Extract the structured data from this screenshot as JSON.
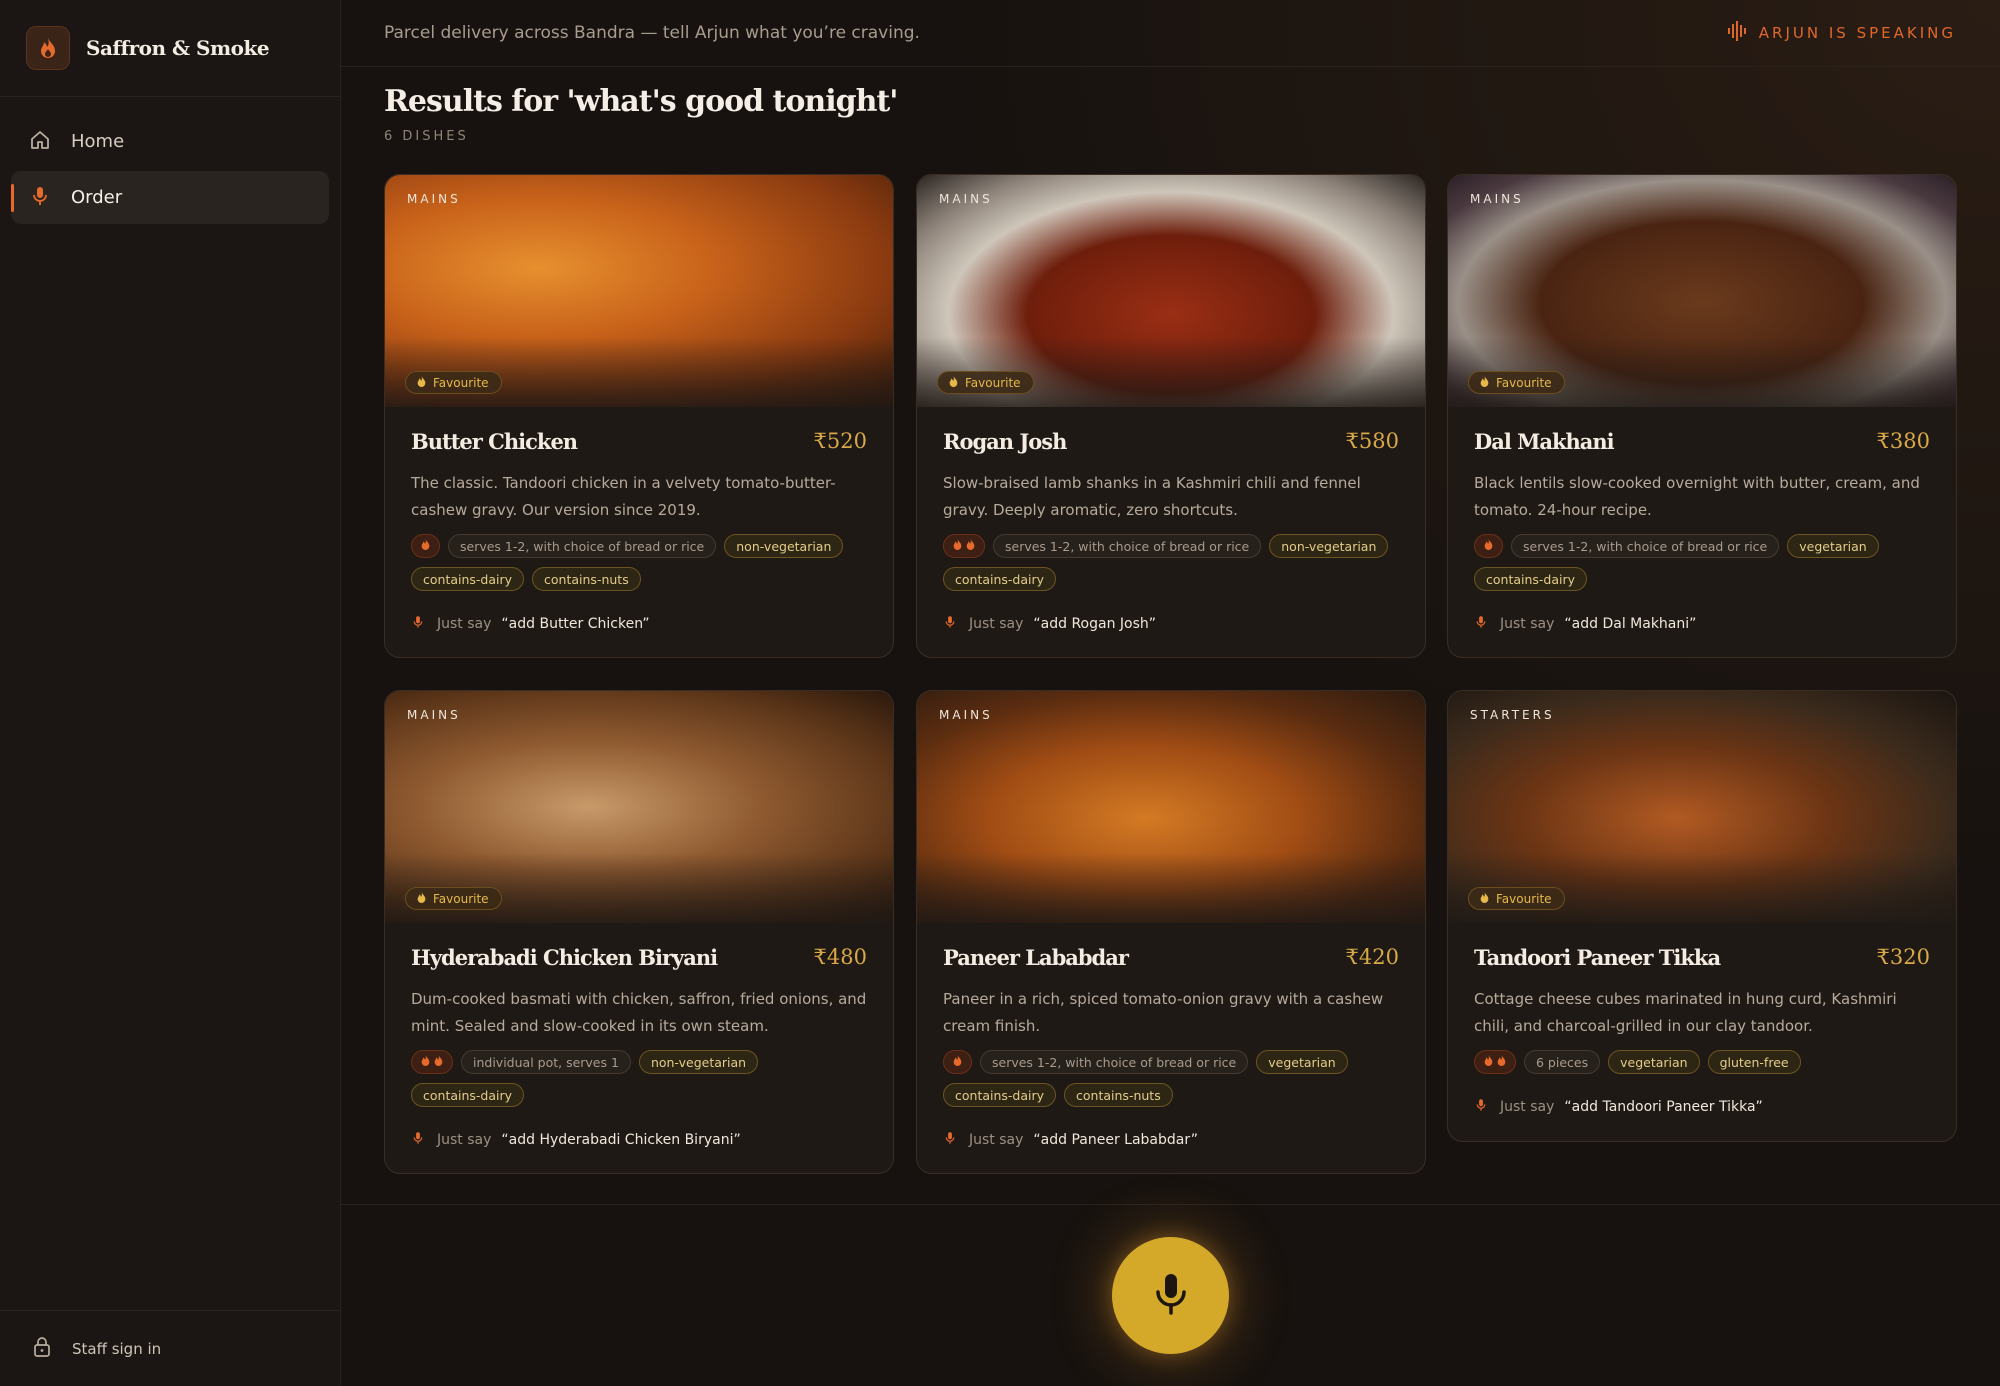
{
  "brand": {
    "name": "Saffron & Smoke",
    "icon": "flame-icon"
  },
  "sidebar": {
    "items": [
      {
        "label": "Home",
        "icon": "home-icon",
        "active": false
      },
      {
        "label": "Order",
        "icon": "mic-icon",
        "active": true
      }
    ],
    "staff_label": "Staff sign in"
  },
  "topbar": {
    "message": "Parcel delivery across Bandra — tell Arjun what you’re craving.",
    "status": "ARJUN IS SPEAKING"
  },
  "results": {
    "title": "Results for 'what's good tonight'",
    "count": "6 DISHES"
  },
  "say_prefix": "Just say",
  "favourite_label": "Favourite",
  "dishes": [
    {
      "category": "MAINS",
      "favourite": true,
      "name": "Butter Chicken",
      "price": "₹520",
      "description": "The classic. Tandoori chicken in a velvety tomato-butter-cashew gravy. Our version since 2019.",
      "spice": 1,
      "serving": "serves 1-2, with choice of bread or rice",
      "tags": [
        "non-vegetarian",
        "contains-dairy",
        "contains-nuts"
      ],
      "command": "“add Butter Chicken”"
    },
    {
      "category": "MAINS",
      "favourite": true,
      "name": "Rogan Josh",
      "price": "₹580",
      "description": "Slow-braised lamb shanks in a Kashmiri chili and fennel gravy. Deeply aromatic, zero shortcuts.",
      "spice": 2,
      "serving": "serves 1-2, with choice of bread or rice",
      "tags": [
        "non-vegetarian",
        "contains-dairy"
      ],
      "command": "“add Rogan Josh”"
    },
    {
      "category": "MAINS",
      "favourite": true,
      "name": "Dal Makhani",
      "price": "₹380",
      "description": "Black lentils slow-cooked overnight with butter, cream, and tomato. 24-hour recipe.",
      "spice": 1,
      "serving": "serves 1-2, with choice of bread or rice",
      "tags": [
        "vegetarian",
        "contains-dairy"
      ],
      "command": "“add Dal Makhani”"
    },
    {
      "category": "MAINS",
      "favourite": true,
      "name": "Hyderabadi Chicken Biryani",
      "price": "₹480",
      "description": "Dum-cooked basmati with chicken, saffron, fried onions, and mint. Sealed and slow-cooked in its own steam.",
      "spice": 2,
      "serving": "individual pot, serves 1",
      "tags": [
        "non-vegetarian",
        "contains-dairy"
      ],
      "command": "“add Hyderabadi Chicken Biryani”"
    },
    {
      "category": "MAINS",
      "favourite": false,
      "name": "Paneer Lababdar",
      "price": "₹420",
      "description": "Paneer in a rich, spiced tomato-onion gravy with a cashew cream finish.",
      "spice": 1,
      "serving": "serves 1-2, with choice of bread or rice",
      "tags": [
        "vegetarian",
        "contains-dairy",
        "contains-nuts"
      ],
      "command": "“add Paneer Lababdar”"
    },
    {
      "category": "STARTERS",
      "favourite": true,
      "name": "Tandoori Paneer Tikka",
      "price": "₹320",
      "description": "Cottage cheese cubes marinated in hung curd, Kashmiri chili, and charcoal-grilled in our clay tandoor.",
      "spice": 2,
      "serving": "6 pieces",
      "tags": [
        "vegetarian",
        "gluten-free"
      ],
      "command": "“add Tandoori Paneer Tikka”"
    }
  ],
  "colors": {
    "accent": "#e56a2c",
    "gold": "#d4a92a",
    "price": "#d9a948",
    "background": "#17120f"
  }
}
